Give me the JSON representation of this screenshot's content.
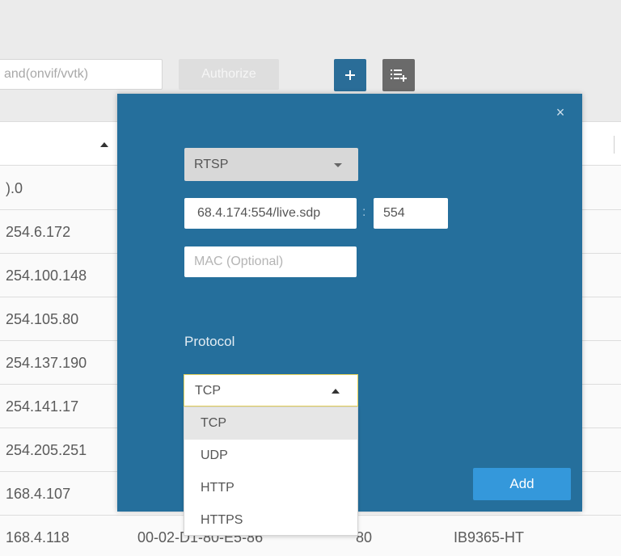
{
  "toolbar": {
    "credential_input_value": "and(onvif/vvtk)",
    "authorize_label": "Authorize",
    "add_device_icon": "plus-icon",
    "import_list_icon": "list-add-icon"
  },
  "table": {
    "rows": [
      {
        "ip": ").0",
        "mac": "",
        "port": "",
        "model": ""
      },
      {
        "ip": "254.6.172",
        "mac": "",
        "port": "",
        "model": ""
      },
      {
        "ip": "254.100.148",
        "mac": "",
        "port": "",
        "model": ""
      },
      {
        "ip": "254.105.80",
        "mac": "",
        "port": "",
        "model": ""
      },
      {
        "ip": "254.137.190",
        "mac": "",
        "port": "",
        "model": ""
      },
      {
        "ip": "254.141.17",
        "mac": "",
        "port": "",
        "model": ""
      },
      {
        "ip": "254.205.251",
        "mac": "",
        "port": "",
        "model": ""
      },
      {
        "ip": "168.4.107",
        "mac": "",
        "port": "",
        "model": ""
      },
      {
        "ip": "168.4.118",
        "mac": "00-02-D1-80-E5-86",
        "port": "80",
        "model": "IB9365-HT"
      }
    ]
  },
  "modal": {
    "close_glyph": "×",
    "stream_type": "RTSP",
    "url_value": "68.4.174:554/live.sdp",
    "port_separator": ":",
    "port_value": "554",
    "mac_placeholder": "MAC (Optional)",
    "protocol_label": "Protocol",
    "protocol_selected": "TCP",
    "protocol_options": [
      "TCP",
      "UDP",
      "HTTP",
      "HTTPS"
    ],
    "add_label": "Add"
  },
  "colors": {
    "modal_bg": "#256f9c",
    "add_button": "#3498db",
    "add_device_button": "#2a6d98",
    "focus_border": "#e6d25a"
  }
}
